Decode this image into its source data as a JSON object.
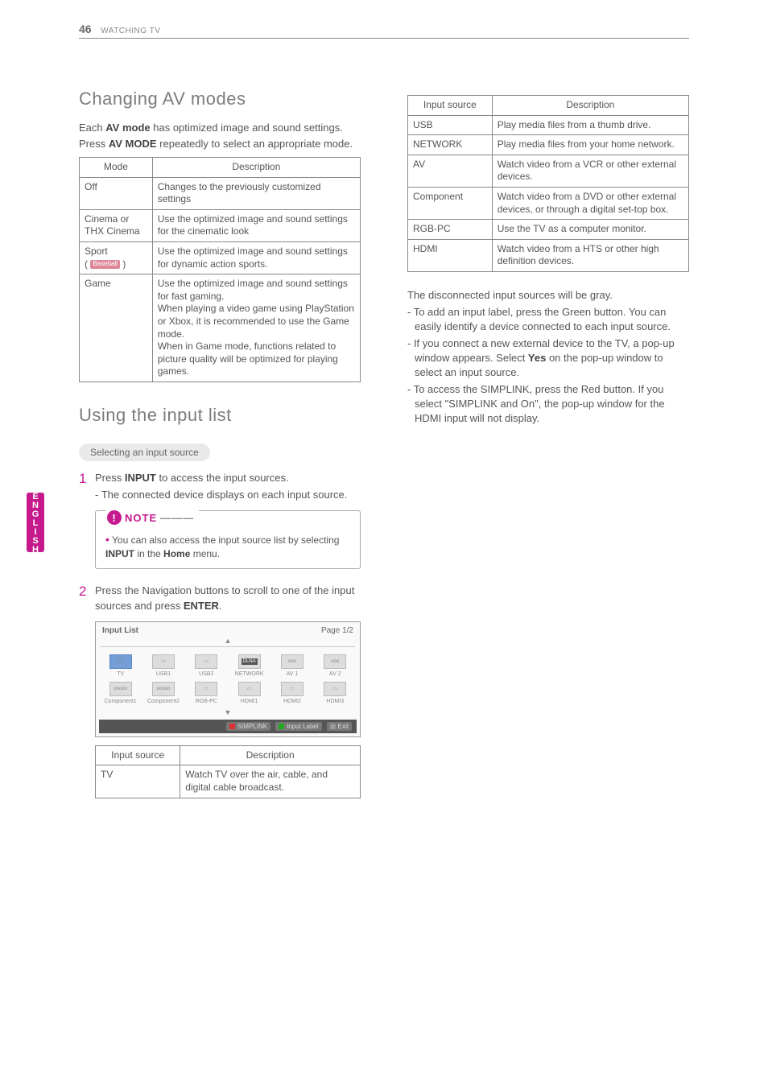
{
  "header": {
    "page": "46",
    "section": "WATCHING TV"
  },
  "sideTab": "ENGLISH",
  "left": {
    "h2a": "Changing AV modes",
    "intro1a": "Each ",
    "intro1b": "AV mode",
    "intro1c": " has optimized image and sound settings.",
    "intro2a": "Press ",
    "intro2b": "AV MODE",
    "intro2c": " repeatedly to select an appropriate mode.",
    "modeTable": {
      "h1": "Mode",
      "h2": "Description",
      "rows": [
        {
          "mode": "Off",
          "desc": "Changes to the previously customized settings"
        },
        {
          "mode": "Cinema or THX Cinema",
          "desc": "Use the optimized image and sound settings for the cinematic look"
        },
        {
          "mode": "Sport",
          "badge": "Baseball",
          "paren1": "( ",
          "paren2": " )",
          "desc": "Use the optimized image and sound settings for dynamic action sports."
        },
        {
          "mode": "Game",
          "desc": "Use the optimized image and sound settings for fast gaming.\nWhen playing a video game using PlayStation or Xbox, it is recommended to use the Game mode.\nWhen in Game mode, functions related to picture quality will be optimized for playing games."
        }
      ]
    },
    "h2b": "Using the input list",
    "pill": "Selecting an input source",
    "step1": {
      "num": "1",
      "a": "Press ",
      "b": "INPUT",
      "c": " to access the input sources.",
      "sub": "- The connected device displays on each input source."
    },
    "note": {
      "label": "NOTE",
      "bullet": "•",
      "a": "You can also access the input source list by selecting ",
      "b": "INPUT",
      "c": " in the ",
      "d": "Home",
      "e": " menu."
    },
    "step2": {
      "num": "2",
      "a": "Press the Navigation buttons to scroll to one of the input sources and press ",
      "b": "ENTER",
      "c": "."
    },
    "panel": {
      "title": "Input List",
      "page": "Page 1/2",
      "icons": [
        "TV",
        "USB1",
        "USB2",
        "NETWORK",
        "AV 1",
        "AV 2",
        "Component1",
        "Component2",
        "RGB-PC",
        "HDMI1",
        "HDMI2",
        "HDMI3"
      ],
      "dlna": "DLNA",
      "footer": {
        "simplink": "SIMPLINK",
        "label": "Input Label",
        "exit": "Exit"
      }
    },
    "srcTable1": {
      "h1": "Input source",
      "h2": "Description",
      "rows": [
        {
          "src": "TV",
          "desc": "Watch TV over the air, cable, and digital cable broadcast."
        }
      ]
    }
  },
  "right": {
    "srcTable2": {
      "h1": "Input source",
      "h2": "Description",
      "rows": [
        {
          "src": "USB",
          "desc": "Play media files from a thumb drive."
        },
        {
          "src": "NETWORK",
          "desc": "Play media files from your home network."
        },
        {
          "src": "AV",
          "desc": "Watch video from a VCR or other external devices."
        },
        {
          "src": "Component",
          "desc": "Watch video from a DVD or other external devices, or through a digital set-top box."
        },
        {
          "src": "RGB-PC",
          "desc": "Use the TV as a computer monitor."
        },
        {
          "src": "HDMI",
          "desc": "Watch video from a HTS or other high definition devices."
        }
      ]
    },
    "para": "The disconnected input sources will be gray.",
    "bullets": [
      "- To add an input label, press the Green button. You can easily identify a device connected to each input source.",
      {
        "a": "- If you connect a new external device to the TV, a pop-up window appears. Select ",
        "b": "Yes",
        "c": " on the pop-up window to select an input source."
      },
      "- To access the SIMPLINK, press the Red button. If you select \"SIMPLINK and On\", the pop-up window for the HDMI input will not display."
    ]
  }
}
